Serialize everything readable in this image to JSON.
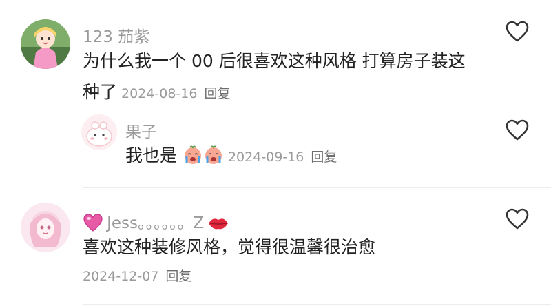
{
  "comments": [
    {
      "username": "123 茄紫",
      "text_line1": "为什么我一个 00 后很喜欢这种风格 打算房子装这",
      "text_line2": "种了",
      "date": "2024-08-16",
      "reply_label": "回复",
      "replies": [
        {
          "username": "果子",
          "text": "我也是",
          "date": "2024-09-16",
          "reply_label": "回复"
        }
      ]
    },
    {
      "username": "Jess。。。。。。Z",
      "text": "喜欢这种装修风格，觉得很温馨很治愈",
      "date": "2024-12-07",
      "reply_label": "回复"
    }
  ],
  "colors": {
    "username": "#9a9a9a",
    "text": "#222222",
    "heart_stroke": "#333333",
    "divider": "#ececec"
  },
  "icons": [
    "heart-outline-icon",
    "crying-emoji-icon",
    "pink-heart-emoji-icon",
    "lips-emoji-icon"
  ]
}
